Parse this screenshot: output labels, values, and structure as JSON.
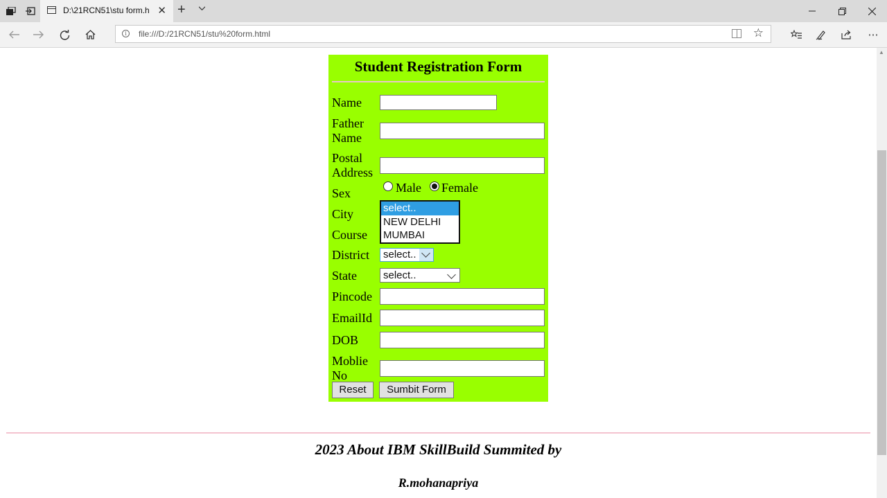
{
  "browser": {
    "tab_title": "D:\\21RCN51\\stu form.h",
    "url": "file:///D:/21RCN51/stu%20form.html"
  },
  "form": {
    "title": "Student Registration Form",
    "labels": {
      "name": "Name",
      "father_1": "Father",
      "father_2": "Name",
      "postal_1": "Postal",
      "postal_2": "Address",
      "sex": "Sex",
      "city": "City",
      "course": "Course",
      "district": "District",
      "state": "State",
      "pincode": "Pincode",
      "email": "EmailId",
      "dob": "DOB",
      "mobile_1": "Moblie",
      "mobile_2": "No"
    },
    "sex_options": {
      "male": "Male",
      "female": "Female",
      "selected": "Female"
    },
    "city_options": [
      "select..",
      "NEW DELHI",
      "MUMBAI"
    ],
    "district_value": "select..",
    "state_value": "select..",
    "buttons": {
      "reset": "Reset",
      "submit": "Sumbit Form"
    }
  },
  "footer": {
    "line1": "2023 About IBM SkillBuild Summited by",
    "line2": "R.mohanapriya"
  },
  "colors": {
    "form_bg": "#99ff00",
    "divider": "#f4c2cf",
    "selected_option": "#2f9ee3"
  }
}
